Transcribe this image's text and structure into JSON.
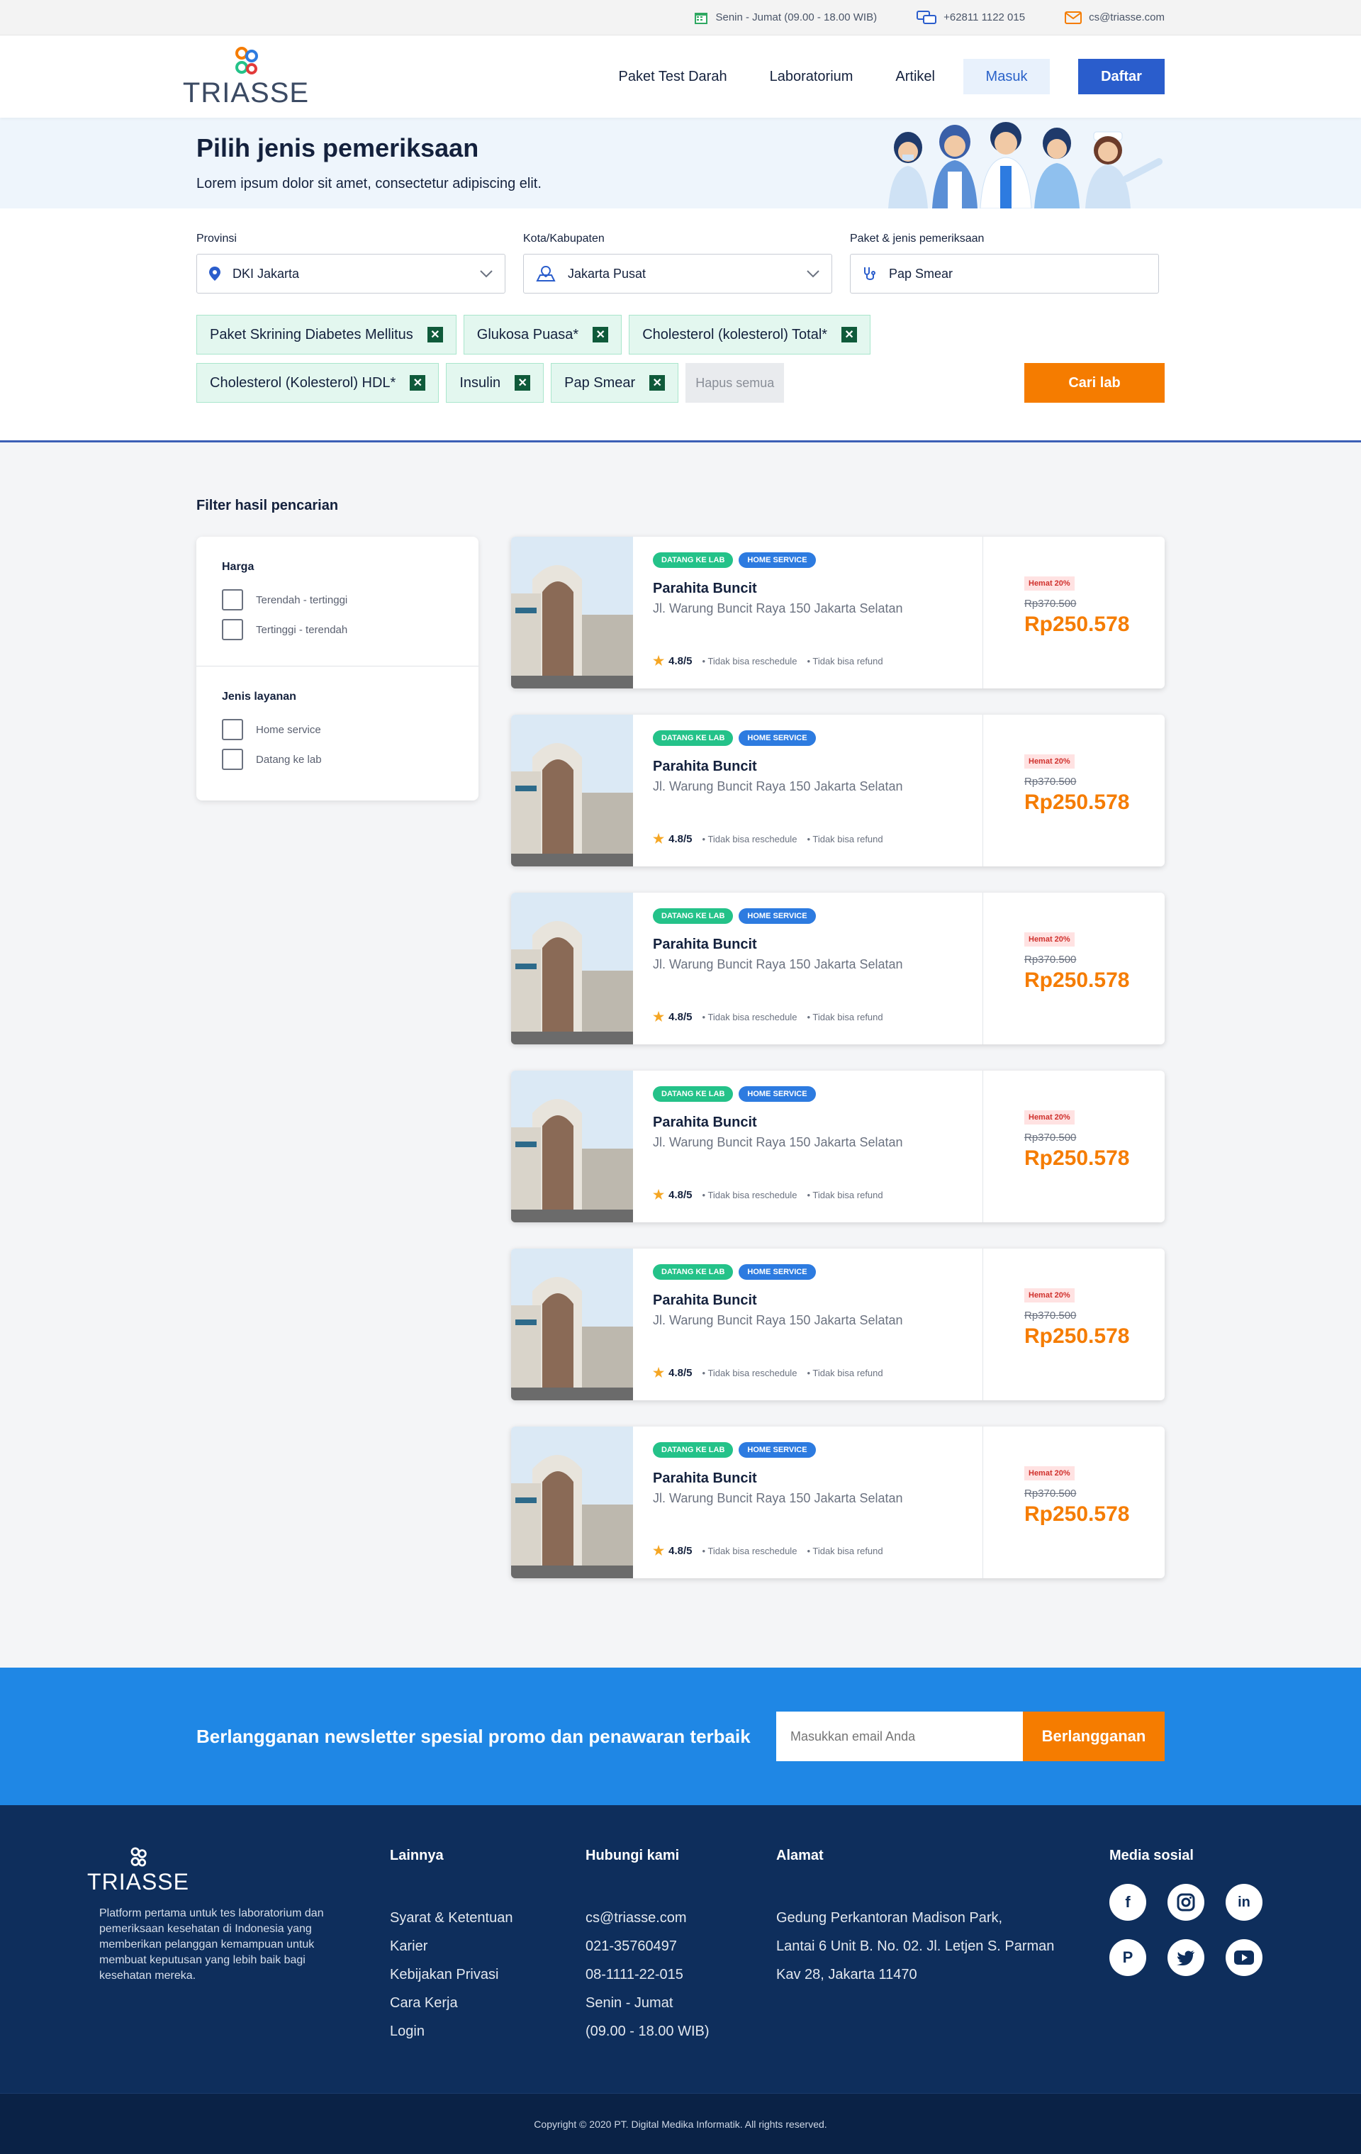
{
  "topbar": {
    "hours": "Senin - Jumat (09.00 - 18.00 WIB)",
    "phone": "+62811 1122 015",
    "email": "cs@triasse.com"
  },
  "brand": {
    "logo_text": "TRIASSE"
  },
  "nav": {
    "items": [
      "Paket Test Darah",
      "Laboratorium",
      "Artikel"
    ],
    "login": "Masuk",
    "register": "Daftar"
  },
  "hero": {
    "title": "Pilih jenis pemeriksaan",
    "subtitle": "Lorem ipsum dolor sit amet, consectetur adipiscing elit."
  },
  "search": {
    "province_label": "Provinsi",
    "province_value": "DKI Jakarta",
    "city_label": "Kota/Kabupaten",
    "city_value": "Jakarta Pusat",
    "package_label": "Paket & jenis pemeriksaan",
    "package_value": "Pap Smear",
    "chips_row1": [
      "Paket Skrining Diabetes Mellitus",
      "Glukosa Puasa*",
      "Cholesterol (kolesterol) Total*"
    ],
    "chips_row2": [
      "Cholesterol (Kolesterol) HDL*",
      "Insulin",
      "Pap Smear"
    ],
    "clear_all": "Hapus semua",
    "submit": "Cari lab"
  },
  "filter": {
    "title": "Filter hasil pencarian",
    "price_heading": "Harga",
    "price_options": [
      "Terendah - tertinggi",
      "Tertinggi - terendah"
    ],
    "service_heading": "Jenis layanan",
    "service_options": [
      "Home service",
      "Datang ke lab"
    ]
  },
  "results": [
    {
      "tag1": "DATANG KE LAB",
      "tag2": "HOME SERVICE",
      "name": "Parahita Buncit",
      "address": "Jl. Warung Buncit Raya 150 Jakarta Selatan",
      "rating": "4.8/5",
      "note1": "Tidak bisa reschedule",
      "note2": "Tidak bisa refund",
      "discount": "Hemat 20%",
      "old_price": "Rp370.500",
      "price": "Rp250.578"
    },
    {
      "tag1": "DATANG KE LAB",
      "tag2": "HOME SERVICE",
      "name": "Parahita Buncit",
      "address": "Jl. Warung Buncit Raya 150 Jakarta Selatan",
      "rating": "4.8/5",
      "note1": "Tidak bisa reschedule",
      "note2": "Tidak bisa refund",
      "discount": "Hemat 20%",
      "old_price": "Rp370.500",
      "price": "Rp250.578"
    },
    {
      "tag1": "DATANG KE LAB",
      "tag2": "HOME SERVICE",
      "name": "Parahita Buncit",
      "address": "Jl. Warung Buncit Raya 150 Jakarta Selatan",
      "rating": "4.8/5",
      "note1": "Tidak bisa reschedule",
      "note2": "Tidak bisa refund",
      "discount": "Hemat 20%",
      "old_price": "Rp370.500",
      "price": "Rp250.578"
    },
    {
      "tag1": "DATANG KE LAB",
      "tag2": "HOME SERVICE",
      "name": "Parahita Buncit",
      "address": "Jl. Warung Buncit Raya 150 Jakarta Selatan",
      "rating": "4.8/5",
      "note1": "Tidak bisa reschedule",
      "note2": "Tidak bisa refund",
      "discount": "Hemat 20%",
      "old_price": "Rp370.500",
      "price": "Rp250.578"
    },
    {
      "tag1": "DATANG KE LAB",
      "tag2": "HOME SERVICE",
      "name": "Parahita Buncit",
      "address": "Jl. Warung Buncit Raya 150 Jakarta Selatan",
      "rating": "4.8/5",
      "note1": "Tidak bisa reschedule",
      "note2": "Tidak bisa refund",
      "discount": "Hemat 20%",
      "old_price": "Rp370.500",
      "price": "Rp250.578"
    },
    {
      "tag1": "DATANG KE LAB",
      "tag2": "HOME SERVICE",
      "name": "Parahita Buncit",
      "address": "Jl. Warung Buncit Raya 150 Jakarta Selatan",
      "rating": "4.8/5",
      "note1": "Tidak bisa reschedule",
      "note2": "Tidak bisa refund",
      "discount": "Hemat 20%",
      "old_price": "Rp370.500",
      "price": "Rp250.578"
    }
  ],
  "newsletter": {
    "text": "Berlangganan newsletter spesial promo dan penawaran terbaik",
    "placeholder": "Masukkan email Anda",
    "button": "Berlangganan"
  },
  "footer": {
    "logo_text": "TRIASSE",
    "description": "Platform pertama untuk tes laboratorium dan pemeriksaan kesehatan di Indonesia yang memberikan pelanggan kemampuan untuk membuat keputusan yang lebih baik bagi kesehatan mereka.",
    "others_heading": "Lainnya",
    "others_links": [
      "Syarat & Ketentuan",
      "Karier",
      "Kebijakan Privasi",
      "Cara Kerja",
      "Login"
    ],
    "contact_heading": "Hubungi kami",
    "contact_lines": [
      "cs@triasse.com",
      "021-35760497",
      "08-1111-22-015",
      "Senin - Jumat",
      "(09.00 - 18.00 WIB)"
    ],
    "address_heading": "Alamat",
    "address_lines": [
      "Gedung Perkantoran Madison Park,",
      "Lantai 6 Unit B. No. 02. Jl. Letjen S. Parman",
      "Kav 28, Jakarta 11470"
    ],
    "social_heading": "Media sosial",
    "socials": [
      "facebook-icon",
      "instagram-icon",
      "linkedin-icon",
      "pinterest-icon",
      "twitter-icon",
      "youtube-icon"
    ],
    "copyright": "Copyright © 2020 PT. Digital Medika Informatik. All rights reserved."
  },
  "colors": {
    "primary": "#2a5dcc",
    "accent": "#f57c00",
    "newsletter_bg": "#1f87e5",
    "footer_bg": "#0e2e5c"
  }
}
